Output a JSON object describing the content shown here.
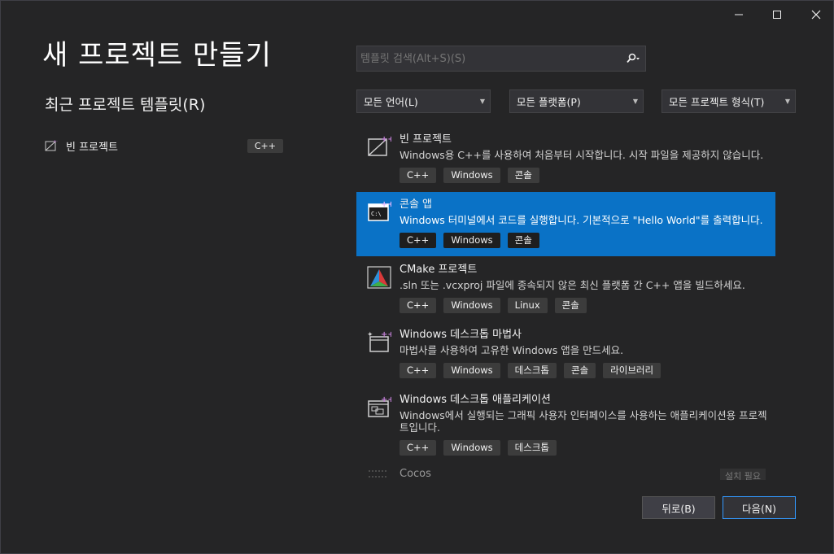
{
  "window": {
    "minimize": "—",
    "maximize": "☐",
    "close": "✕"
  },
  "page_title": "새 프로젝트 만들기",
  "recent": {
    "heading": "최근 프로젝트 템플릿(R)",
    "items": [
      {
        "label": "빈 프로젝트",
        "tag": "C++"
      }
    ]
  },
  "search": {
    "placeholder": "템플릿 검색(Alt+S)(S)",
    "value": ""
  },
  "filters": {
    "language": "모든 언어(L)",
    "platform": "모든 플랫폼(P)",
    "project_type": "모든 프로젝트 형식(T)"
  },
  "templates": [
    {
      "name": "빈 프로젝트",
      "desc": "Windows용 C++를 사용하여 처음부터 시작합니다. 시작 파일을 제공하지 않습니다.",
      "tags": [
        "C++",
        "Windows",
        "콘솔"
      ]
    },
    {
      "name": "콘솔 앱",
      "desc": "Windows 터미널에서 코드를 실행합니다. 기본적으로 \"Hello World\"를 출력합니다.",
      "tags": [
        "C++",
        "Windows",
        "콘솔"
      ]
    },
    {
      "name": "CMake 프로젝트",
      "desc": ".sln 또는 .vcxproj 파일에 종속되지 않은 최신 플랫폼 간 C++ 앱을 빌드하세요.",
      "tags": [
        "C++",
        "Windows",
        "Linux",
        "콘솔"
      ]
    },
    {
      "name": "Windows 데스크톱 마법사",
      "desc": "마법사를 사용하여 고유한 Windows 앱을 만드세요.",
      "tags": [
        "C++",
        "Windows",
        "데스크톱",
        "콘솔",
        "라이브러리"
      ]
    },
    {
      "name": "Windows 데스크톱 애플리케이션",
      "desc": "Windows에서 실행되는 그래픽 사용자 인터페이스를 사용하는 애플리케이션용 프로젝트입니다.",
      "tags": [
        "C++",
        "Windows",
        "데스크톱"
      ]
    },
    {
      "name": "Cocos",
      "badge": "설치 필요"
    }
  ],
  "buttons": {
    "back": "뒤로(B)",
    "next": "다음(N)"
  },
  "colors": {
    "background": "#252526",
    "selected": "#0a72c6",
    "accent_border": "#3399ff"
  }
}
